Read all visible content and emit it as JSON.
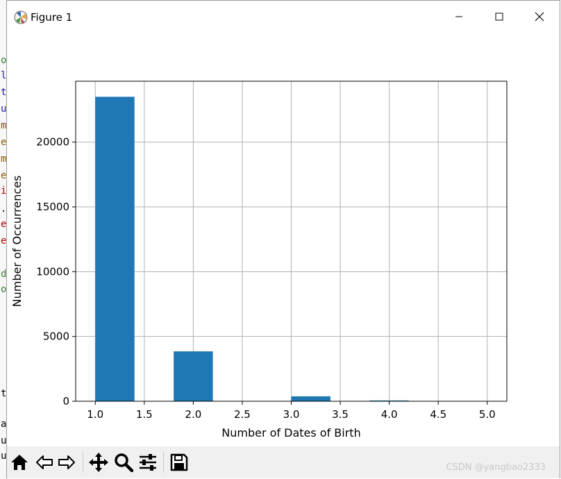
{
  "window": {
    "title": "Figure 1",
    "icon": "matplotlib-icon",
    "controls": [
      "minimize-icon",
      "maximize-icon",
      "close-icon"
    ]
  },
  "toolbar": {
    "buttons": [
      {
        "icon": "home-icon",
        "label": "Home"
      },
      {
        "icon": "back-arrow-icon",
        "label": "Back"
      },
      {
        "icon": "forward-arrow-icon",
        "label": "Forward"
      },
      {
        "icon": "pan-icon",
        "label": "Pan"
      },
      {
        "icon": "zoom-icon",
        "label": "Zoom"
      },
      {
        "icon": "configure-subplots-icon",
        "label": "Subplots"
      },
      {
        "icon": "save-icon",
        "label": "Save"
      }
    ]
  },
  "watermark": "CSDN @yangbao2333",
  "chart_data": {
    "type": "bar",
    "title": "",
    "xlabel": "Number of Dates of Birth",
    "ylabel": "Number of Occurrences",
    "xlim": [
      0.8,
      5.2
    ],
    "ylim": [
      0,
      24700
    ],
    "grid": true,
    "bar_color": "#1f77b4",
    "bins": [
      {
        "x0": 1.0,
        "x1": 1.4,
        "value": 23500
      },
      {
        "x0": 1.4,
        "x1": 1.8,
        "value": 0
      },
      {
        "x0": 1.8,
        "x1": 2.2,
        "value": 3850
      },
      {
        "x0": 2.2,
        "x1": 2.6,
        "value": 0
      },
      {
        "x0": 2.6,
        "x1": 3.0,
        "value": 0
      },
      {
        "x0": 3.0,
        "x1": 3.4,
        "value": 380
      },
      {
        "x0": 3.4,
        "x1": 3.8,
        "value": 0
      },
      {
        "x0": 3.8,
        "x1": 4.2,
        "value": 60
      },
      {
        "x0": 4.2,
        "x1": 4.6,
        "value": 0
      },
      {
        "x0": 4.6,
        "x1": 5.0,
        "value": 10
      }
    ],
    "xticks": [
      1.0,
      1.5,
      2.0,
      2.5,
      3.0,
      3.5,
      4.0,
      4.5,
      5.0
    ],
    "xtick_labels": [
      "1.0",
      "1.5",
      "2.0",
      "2.5",
      "3.0",
      "3.5",
      "4.0",
      "4.5",
      "5.0"
    ],
    "yticks": [
      0,
      5000,
      10000,
      15000,
      20000
    ],
    "ytick_labels": [
      "0",
      "5000",
      "10000",
      "15000",
      "20000"
    ]
  }
}
